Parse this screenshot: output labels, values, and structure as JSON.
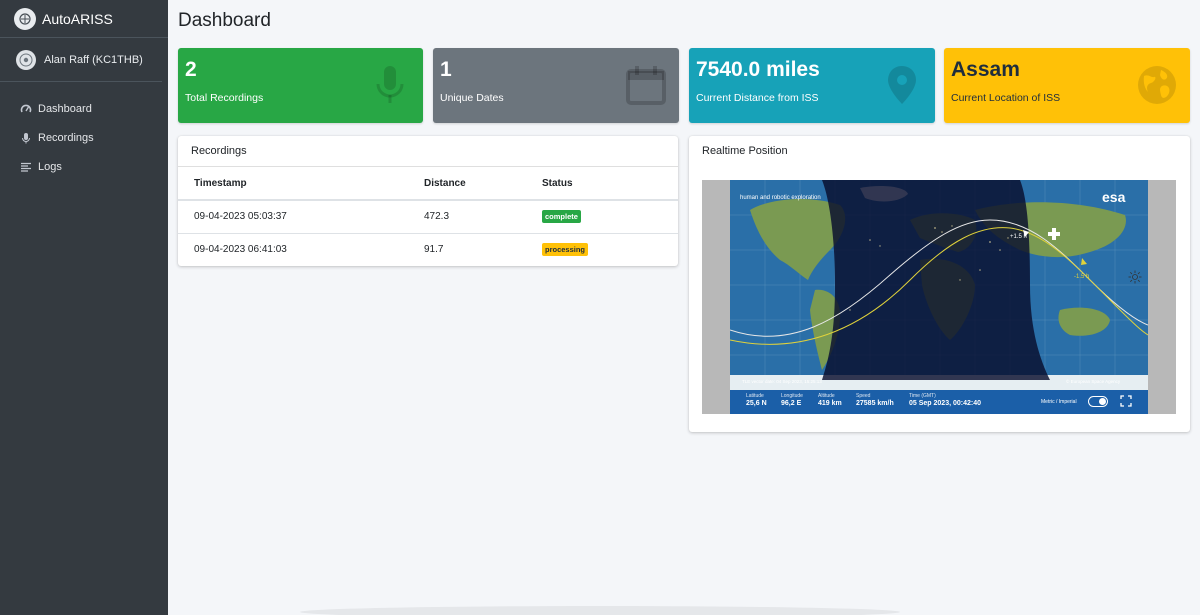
{
  "brand": {
    "name": "AutoARISS"
  },
  "user": {
    "name": "Alan Raff (KC1THB)"
  },
  "nav": [
    {
      "label": "Dashboard",
      "icon": "tachometer-icon"
    },
    {
      "label": "Recordings",
      "icon": "microphone-icon"
    },
    {
      "label": "Logs",
      "icon": "list-icon"
    }
  ],
  "page": {
    "title": "Dashboard"
  },
  "stats": [
    {
      "value": "2",
      "label": "Total Recordings",
      "icon": "microphone-icon",
      "color": "#28a745"
    },
    {
      "value": "1",
      "label": "Unique Dates",
      "icon": "calendar-icon",
      "color": "#6c757d"
    },
    {
      "value": "7540.0 miles",
      "label": "Current Distance from ISS",
      "icon": "map-marker-icon",
      "color": "#17a2b8"
    },
    {
      "value": "Assam",
      "label": "Current Location of ISS",
      "icon": "globe-icon",
      "color": "#ffc107"
    }
  ],
  "recordings": {
    "title": "Recordings",
    "columns": [
      "Timestamp",
      "Distance",
      "Status"
    ],
    "rows": [
      {
        "timestamp": "09-04-2023 05:03:37",
        "distance": "472.3",
        "status": "complete"
      },
      {
        "timestamp": "09-04-2023 06:41:03",
        "distance": "91.7",
        "status": "processing"
      }
    ]
  },
  "realtime": {
    "title": "Realtime Position",
    "map": {
      "header_text": "human and robotic exploration",
      "logo_text": "esa",
      "tle_text": "TLE vector date: 04 Sep 2023, 15:25:13",
      "copyright": "© European Space Agency",
      "orbit_label_1": "+1.5 h",
      "orbit_label_2": "-1.5 h",
      "toggle_label": "Metric / Imperial",
      "readouts": [
        {
          "label": "Latitude",
          "value": "25,6 N"
        },
        {
          "label": "Longitude",
          "value": "96,2 E"
        },
        {
          "label": "Altitude",
          "value": "419 km"
        },
        {
          "label": "Speed",
          "value": "27585 km/h"
        },
        {
          "label": "Time (GMT)",
          "value": "05 Sep 2023, 00:42:40"
        }
      ]
    }
  }
}
